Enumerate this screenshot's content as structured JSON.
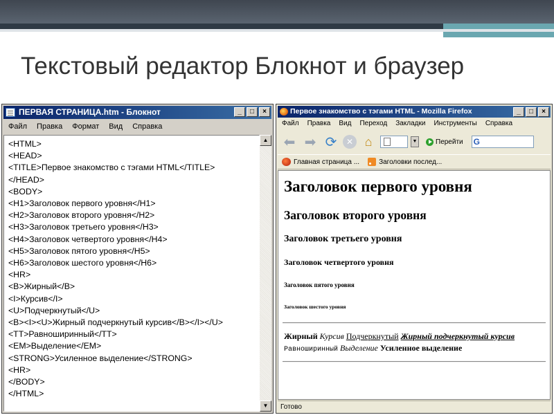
{
  "slide": {
    "title": "Текстовый редактор Блокнот и браузер"
  },
  "notepad": {
    "title": "ПЕРВАЯ СТРАНИЦА.htm - Блокнот",
    "menu": [
      "Файл",
      "Правка",
      "Формат",
      "Вид",
      "Справка"
    ],
    "lines": [
      "<HTML>",
      "<HEAD>",
      "<TITLE>Первое знакомство с тэгами HTML</TITLE>",
      "</HEAD>",
      "<BODY>",
      "<H1>Заголовок первого уровня</H1>",
      "<H2>Заголовок второго уровня</H2>",
      "<H3>Заголовок третьего уровня</H3>",
      "<H4>Заголовок четвертого уровня</H4>",
      "<H5>Заголовок пятого уровня</H5>",
      "<H6>Заголовок шестого уровня</H6>",
      "<HR>",
      "<B>Жирный</B>",
      "<I>Курсив</I>",
      "<U>Подчеркнутый</U>",
      "<B><I><U>Жирный подчеркнутый курсив</B></I></U>",
      "<TT>Равноширинный</TT>",
      "<EM>Выделение</EM>",
      "<STRONG>Усиленное выделение</STRONG>",
      "<HR>",
      "</BODY>",
      "</HTML>"
    ]
  },
  "firefox": {
    "title": "Первое знакомство с тэгами HTML - Mozilla Firefox",
    "menu": [
      "Файл",
      "Правка",
      "Вид",
      "Переход",
      "Закладки",
      "Инструменты",
      "Справка"
    ],
    "go_label": "Перейти",
    "bookmarks": [
      "Главная страница ...",
      "Заголовки послед..."
    ],
    "headings": {
      "h1": "Заголовок первого уровня",
      "h2": "Заголовок второго уровня",
      "h3": "Заголовок третьего уровня",
      "h4": "Заголовок четвертого уровня",
      "h5": "Заголовок пятого уровня",
      "h6": "Заголовок шестого уровня"
    },
    "para": {
      "bold": "Жирный",
      "italic": "Курсив",
      "underline": "Подчеркнутый",
      "bui": "Жирный подчеркнутый курсив",
      "tt": "Равноширинный",
      "em": "Выделение",
      "strong": "Усиленное выделение"
    },
    "status": "Готово"
  }
}
